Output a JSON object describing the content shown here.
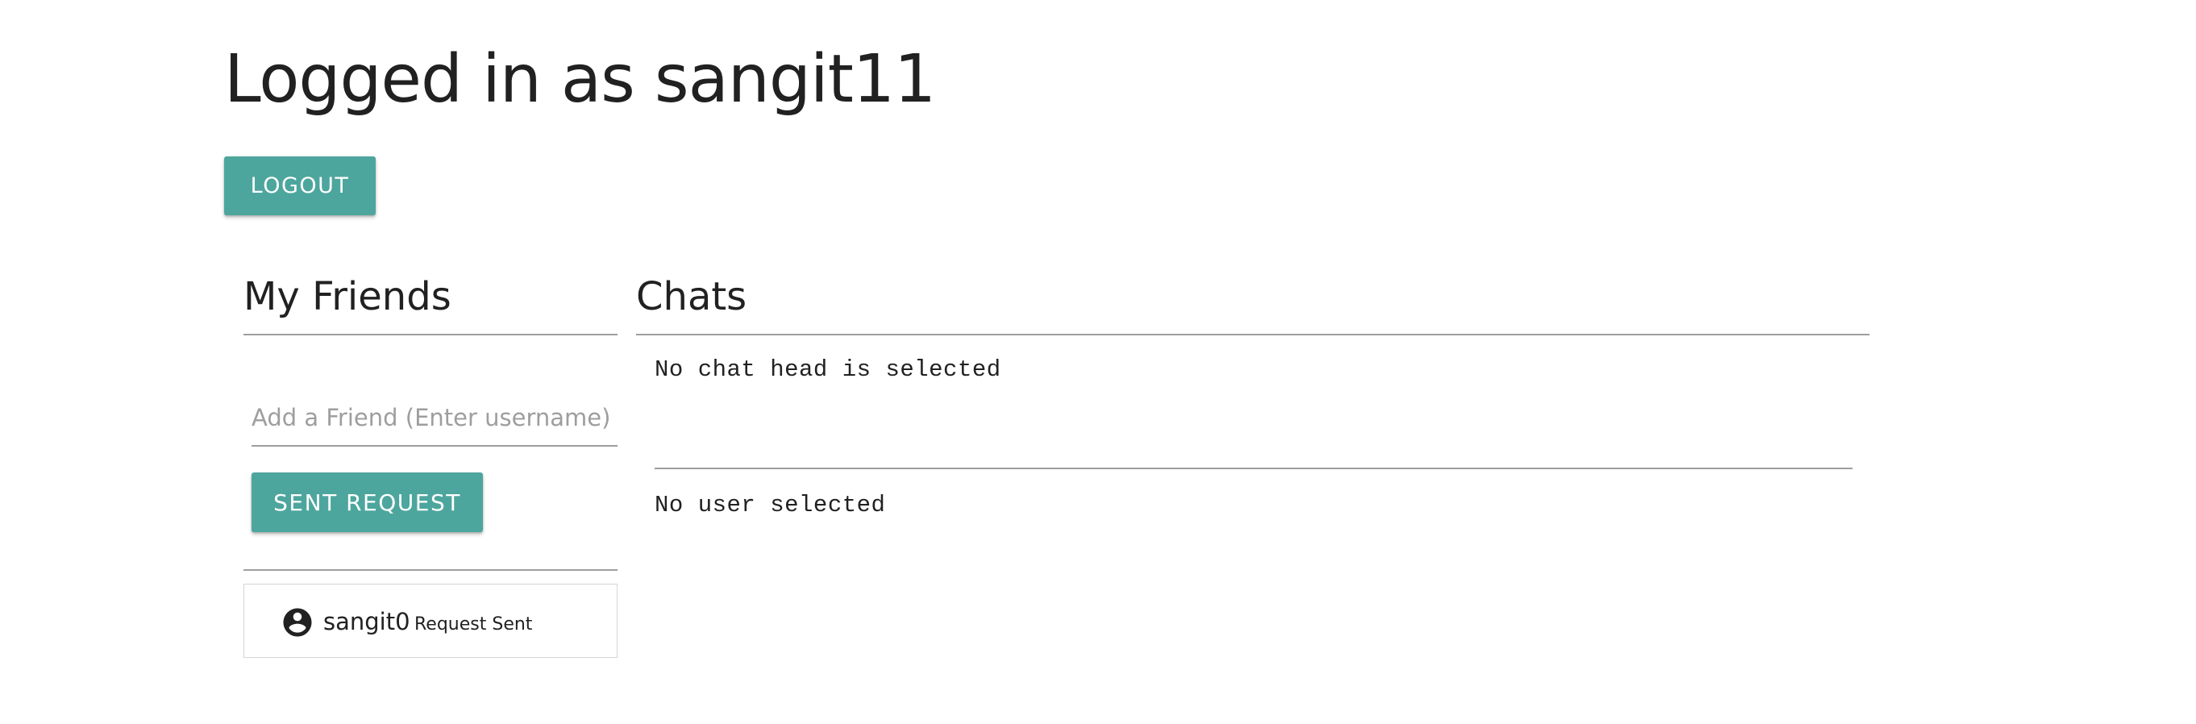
{
  "header": {
    "title": "Logged in as sangit11",
    "logout_label": "LOGOUT"
  },
  "friends": {
    "heading": "My Friends",
    "add_input": {
      "value": "",
      "placeholder": "Add a Friend (Enter username)"
    },
    "send_label": "SENT REQUEST",
    "items": [
      {
        "username": "sangit0",
        "status": "Request Sent",
        "icon": "account-circle-icon"
      }
    ]
  },
  "chats": {
    "heading": "Chats",
    "chat_head_status": "No chat head is selected",
    "user_status": "No user selected"
  },
  "colors": {
    "accent": "#4da69d",
    "divider": "#9e9e9e",
    "text": "#212121",
    "placeholder": "#9e9e9e"
  }
}
